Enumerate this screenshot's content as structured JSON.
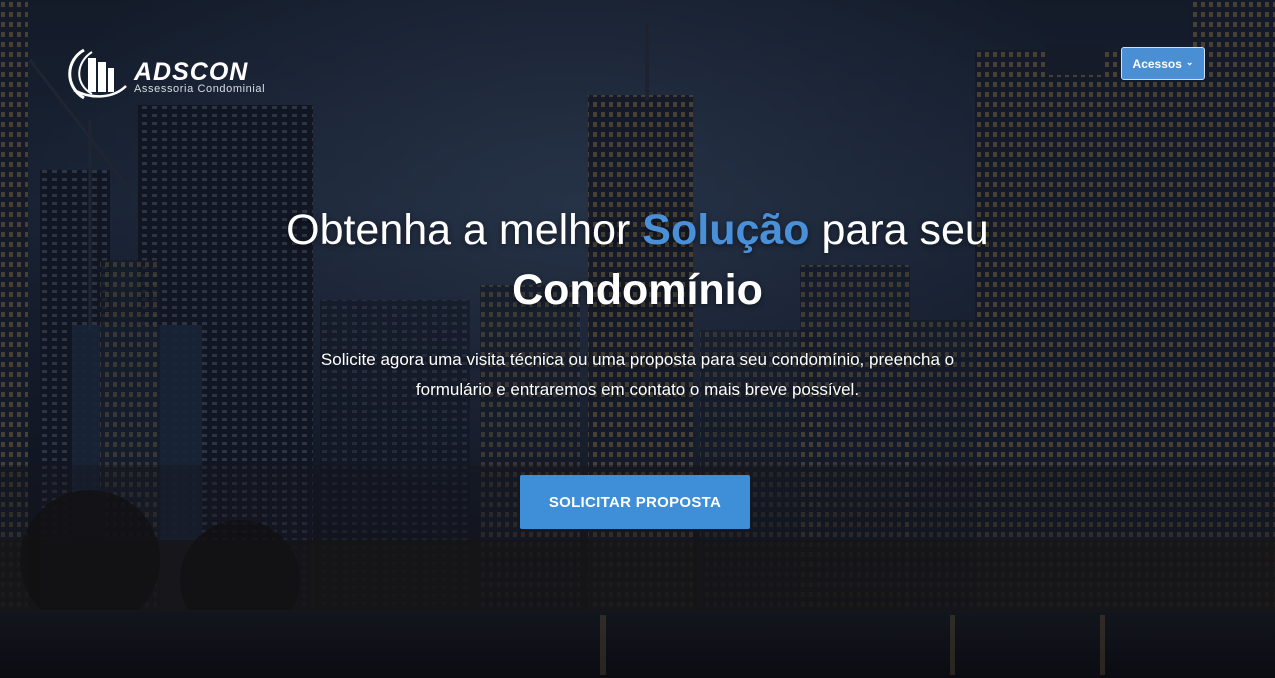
{
  "brand": {
    "name": "ADSCON",
    "tagline": "Assessoria Condominial",
    "logo_icon": "building-swoosh-icon"
  },
  "nav": {
    "access_label": "Acessos",
    "access_icon": "chevron-down-icon"
  },
  "hero": {
    "headline_pre": "Obtenha a melhor ",
    "headline_accent": "Solução",
    "headline_post": " para seu",
    "headline_bold": "Condomínio",
    "lead_line1": "Solicite agora uma visita técnica ou uma proposta para seu condomínio, preencha o",
    "lead_line2": "formulário e entraremos em contato o mais breve possível.",
    "cta_label": "SOLICITAR PROPOSTA"
  },
  "colors": {
    "accent": "#4a90d9",
    "button": "#3f8fd8",
    "text": "#ffffff"
  }
}
